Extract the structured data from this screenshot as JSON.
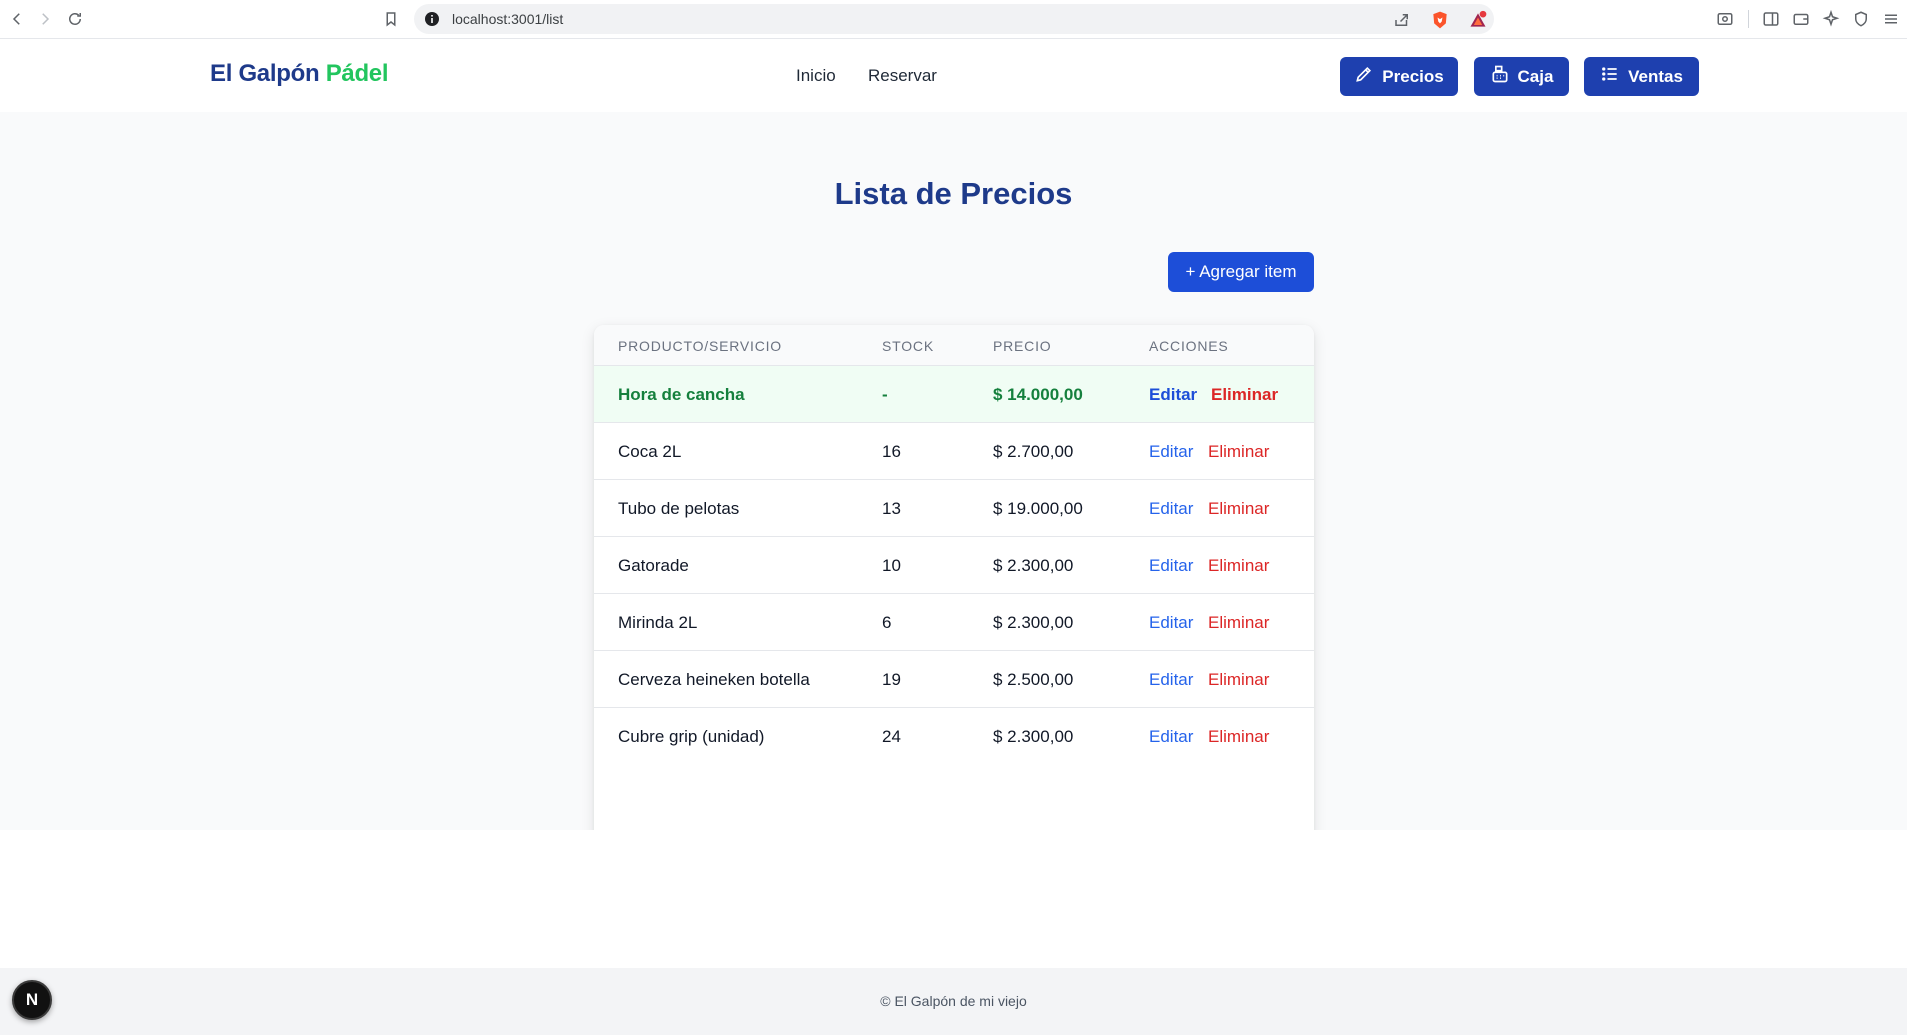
{
  "browser": {
    "url": "localhost:3001/list"
  },
  "header": {
    "logo_part1": "El Galpón",
    "logo_part2": "Pádel",
    "nav": [
      {
        "label": "Inicio"
      },
      {
        "label": "Reservar"
      }
    ],
    "buttons": [
      {
        "label": "Precios",
        "icon": "pen-icon"
      },
      {
        "label": "Caja",
        "icon": "cash-register-icon"
      },
      {
        "label": "Ventas",
        "icon": "list-icon"
      }
    ]
  },
  "main": {
    "title": "Lista de Precios",
    "add_button": "+ Agregar item",
    "table": {
      "headers": [
        "PRODUCTO/SERVICIO",
        "STOCK",
        "PRECIO",
        "ACCIONES"
      ],
      "edit_label": "Editar",
      "delete_label": "Eliminar",
      "rows": [
        {
          "product": "Hora de cancha",
          "stock": "-",
          "price": "$ 14.000,00",
          "highlight": true
        },
        {
          "product": "Coca 2L",
          "stock": "16",
          "price": "$ 2.700,00"
        },
        {
          "product": "Tubo de pelotas",
          "stock": "13",
          "price": "$ 19.000,00"
        },
        {
          "product": "Gatorade",
          "stock": "10",
          "price": "$ 2.300,00"
        },
        {
          "product": "Mirinda 2L",
          "stock": "6",
          "price": "$ 2.300,00"
        },
        {
          "product": "Cerveza heineken botella",
          "stock": "19",
          "price": "$ 2.500,00"
        },
        {
          "product": "Cubre grip (unidad)",
          "stock": "24",
          "price": "$ 2.300,00"
        }
      ]
    }
  },
  "footer": {
    "text": "© El Galpón de mi viejo"
  },
  "dev_badge": "N",
  "colors": {
    "brand_dark": "#1e3a8a",
    "brand_green": "#22c55e",
    "button_blue": "#1e40af",
    "link_blue": "#2563eb",
    "danger": "#dc2626",
    "highlight_row": "#f0fdf4"
  }
}
